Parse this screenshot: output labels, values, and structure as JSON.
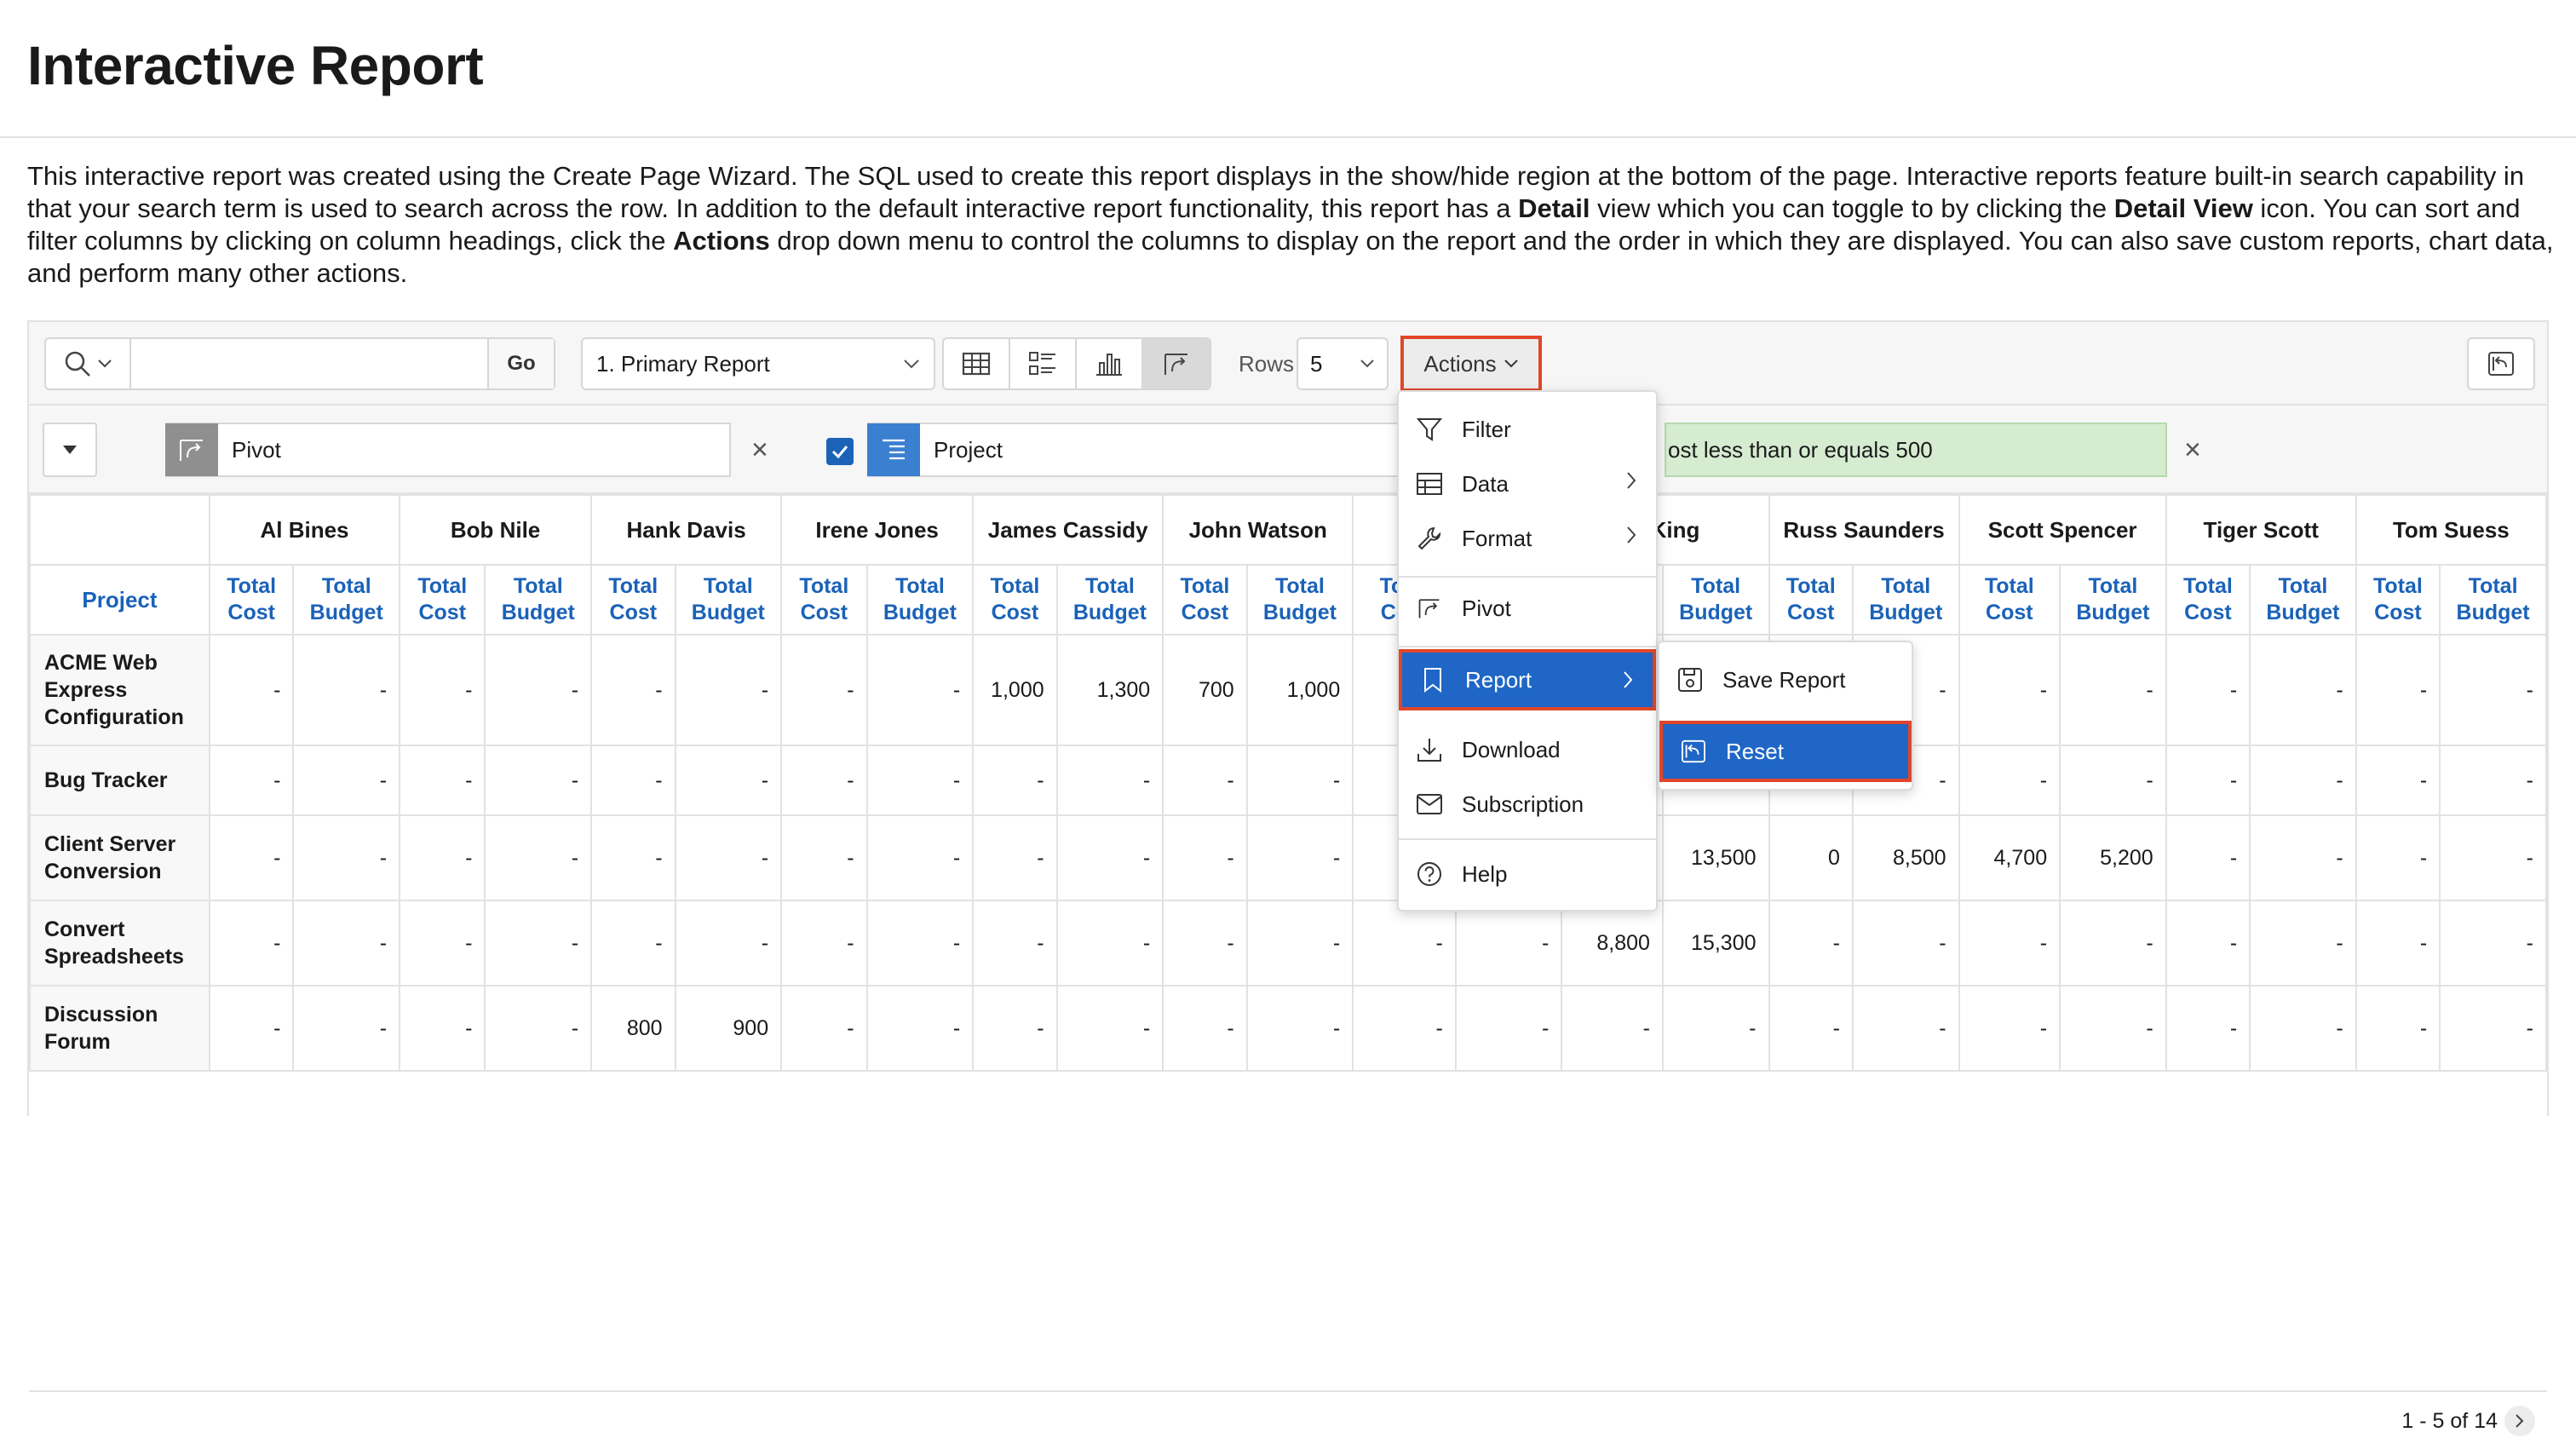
{
  "page": {
    "title": "Interactive Report",
    "intro": {
      "p1": "This interactive report was created using the Create Page Wizard. The SQL used to create this report displays in the show/hide region at the bottom of the page. Interactive reports feature built-in search capability in that your search term is used to search across the row. In addition to the default interactive report functionality, this report has a ",
      "b1": "Detail",
      "p2": " view which you can toggle to by clicking the ",
      "b2": "Detail View",
      "p3": " icon. You can sort and filter columns by clicking on column headings, click the ",
      "b3": "Actions",
      "p4": " drop down menu to control the columns to display on the report and the order in which they are displayed. You can also save custom reports, chart data, and perform many other actions."
    }
  },
  "toolbar": {
    "search_value": "",
    "go_label": "Go",
    "report_select": "1. Primary Report",
    "rows_label": "Rows",
    "rows_value": "5",
    "actions_label": "Actions"
  },
  "filters": {
    "pivot_label": "Pivot",
    "project_label": "Project",
    "cost_filter": "Cost less than or equals 500",
    "cost_filter_visible": "ost less than or equals 500"
  },
  "table": {
    "row_header": "Project",
    "sub_cost": "Total Cost",
    "sub_budget": "Total Budget",
    "groups": [
      "Al Bines",
      "Bob Nile",
      "Hank Davis",
      "Irene Jones",
      "James Cassidy",
      "John Watson",
      "",
      "n King",
      "Russ Saunders",
      "Scott Spencer",
      "Tiger Scott",
      "Tom Suess"
    ],
    "rows": [
      {
        "project": "ACME Web Express Configuration",
        "cells": [
          "-",
          "-",
          "-",
          "-",
          "-",
          "-",
          "-",
          "-",
          "1,000",
          "1,300",
          "700",
          "1,000",
          "",
          "",
          "",
          "",
          "-",
          "-",
          "-",
          "-",
          "-",
          "-",
          "-",
          "-"
        ]
      },
      {
        "project": "Bug Tracker",
        "cells": [
          "-",
          "-",
          "-",
          "-",
          "-",
          "-",
          "-",
          "-",
          "-",
          "-",
          "-",
          "-",
          "4,",
          "",
          "",
          "",
          "-",
          "-",
          "-",
          "-",
          "-",
          "-",
          "-",
          "-"
        ]
      },
      {
        "project": "Client Server Conversion",
        "cells": [
          "-",
          "-",
          "-",
          "-",
          "-",
          "-",
          "-",
          "-",
          "-",
          "-",
          "-",
          "-",
          "",
          "",
          "",
          "13,500",
          "0",
          "8,500",
          "4,700",
          "5,200",
          "-",
          "-",
          "-",
          "-"
        ]
      },
      {
        "project": "Convert Spreadsheets",
        "cells": [
          "-",
          "-",
          "-",
          "-",
          "-",
          "-",
          "-",
          "-",
          "-",
          "-",
          "-",
          "-",
          "-",
          "-",
          "8,800",
          "15,300",
          "-",
          "-",
          "-",
          "-",
          "-",
          "-",
          "-",
          "-"
        ]
      },
      {
        "project": "Discussion Forum",
        "cells": [
          "-",
          "-",
          "-",
          "-",
          "800",
          "900",
          "-",
          "-",
          "-",
          "-",
          "-",
          "-",
          "-",
          "-",
          "-",
          "-",
          "-",
          "-",
          "-",
          "-",
          "-",
          "-",
          "-",
          "-"
        ]
      }
    ],
    "pagination": "1 - 5 of 14"
  },
  "actions_menu": {
    "items": [
      {
        "label": "Filter",
        "icon": "filter-icon"
      },
      {
        "label": "Data",
        "icon": "table-icon"
      },
      {
        "label": "Format",
        "icon": "wrench-icon"
      },
      {
        "label": "Pivot",
        "icon": "pivot-icon"
      },
      {
        "label": "Report",
        "icon": "bookmark-icon"
      },
      {
        "label": "Download",
        "icon": "download-icon"
      },
      {
        "label": "Subscription",
        "icon": "envelope-icon"
      },
      {
        "label": "Help",
        "icon": "help-icon"
      }
    ]
  },
  "report_submenu": {
    "items": [
      {
        "label": "Save Report",
        "icon": "save-icon"
      },
      {
        "label": "Reset",
        "icon": "reset-icon"
      }
    ]
  },
  "colors": {
    "accent_blue": "#1f66c6",
    "highlight_red": "#e0462a",
    "link_blue": "#1a62b9",
    "filter_green": "#d5ecd0"
  }
}
